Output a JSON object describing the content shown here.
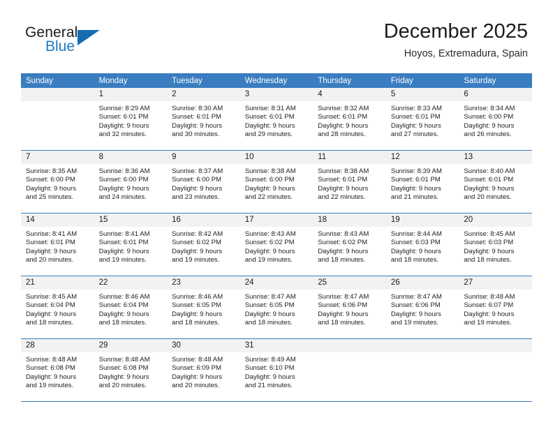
{
  "brand": {
    "name_part1": "General",
    "name_part2": "Blue",
    "accent_color": "#1f78c1",
    "flag_color": "#156cb0"
  },
  "header": {
    "month_title": "December 2025",
    "location": "Hoyos, Extremadura, Spain"
  },
  "calendar": {
    "header_bg": "#3a7dc0",
    "daynum_bg": "#f2f2f2",
    "weekday_headers": [
      "Sunday",
      "Monday",
      "Tuesday",
      "Wednesday",
      "Thursday",
      "Friday",
      "Saturday"
    ],
    "labels": {
      "sunrise": "Sunrise:",
      "sunset": "Sunset:",
      "daylight": "Daylight:"
    },
    "weeks": [
      [
        {
          "day": "",
          "empty": true
        },
        {
          "day": "1",
          "sunrise": "Sunrise: 8:29 AM",
          "sunset": "Sunset: 6:01 PM",
          "daylight_line1": "Daylight: 9 hours",
          "daylight_line2": "and 32 minutes."
        },
        {
          "day": "2",
          "sunrise": "Sunrise: 8:30 AM",
          "sunset": "Sunset: 6:01 PM",
          "daylight_line1": "Daylight: 9 hours",
          "daylight_line2": "and 30 minutes."
        },
        {
          "day": "3",
          "sunrise": "Sunrise: 8:31 AM",
          "sunset": "Sunset: 6:01 PM",
          "daylight_line1": "Daylight: 9 hours",
          "daylight_line2": "and 29 minutes."
        },
        {
          "day": "4",
          "sunrise": "Sunrise: 8:32 AM",
          "sunset": "Sunset: 6:01 PM",
          "daylight_line1": "Daylight: 9 hours",
          "daylight_line2": "and 28 minutes."
        },
        {
          "day": "5",
          "sunrise": "Sunrise: 8:33 AM",
          "sunset": "Sunset: 6:01 PM",
          "daylight_line1": "Daylight: 9 hours",
          "daylight_line2": "and 27 minutes."
        },
        {
          "day": "6",
          "sunrise": "Sunrise: 8:34 AM",
          "sunset": "Sunset: 6:00 PM",
          "daylight_line1": "Daylight: 9 hours",
          "daylight_line2": "and 26 minutes."
        }
      ],
      [
        {
          "day": "7",
          "sunrise": "Sunrise: 8:35 AM",
          "sunset": "Sunset: 6:00 PM",
          "daylight_line1": "Daylight: 9 hours",
          "daylight_line2": "and 25 minutes."
        },
        {
          "day": "8",
          "sunrise": "Sunrise: 8:36 AM",
          "sunset": "Sunset: 6:00 PM",
          "daylight_line1": "Daylight: 9 hours",
          "daylight_line2": "and 24 minutes."
        },
        {
          "day": "9",
          "sunrise": "Sunrise: 8:37 AM",
          "sunset": "Sunset: 6:00 PM",
          "daylight_line1": "Daylight: 9 hours",
          "daylight_line2": "and 23 minutes."
        },
        {
          "day": "10",
          "sunrise": "Sunrise: 8:38 AM",
          "sunset": "Sunset: 6:00 PM",
          "daylight_line1": "Daylight: 9 hours",
          "daylight_line2": "and 22 minutes."
        },
        {
          "day": "11",
          "sunrise": "Sunrise: 8:38 AM",
          "sunset": "Sunset: 6:01 PM",
          "daylight_line1": "Daylight: 9 hours",
          "daylight_line2": "and 22 minutes."
        },
        {
          "day": "12",
          "sunrise": "Sunrise: 8:39 AM",
          "sunset": "Sunset: 6:01 PM",
          "daylight_line1": "Daylight: 9 hours",
          "daylight_line2": "and 21 minutes."
        },
        {
          "day": "13",
          "sunrise": "Sunrise: 8:40 AM",
          "sunset": "Sunset: 6:01 PM",
          "daylight_line1": "Daylight: 9 hours",
          "daylight_line2": "and 20 minutes."
        }
      ],
      [
        {
          "day": "14",
          "sunrise": "Sunrise: 8:41 AM",
          "sunset": "Sunset: 6:01 PM",
          "daylight_line1": "Daylight: 9 hours",
          "daylight_line2": "and 20 minutes."
        },
        {
          "day": "15",
          "sunrise": "Sunrise: 8:41 AM",
          "sunset": "Sunset: 6:01 PM",
          "daylight_line1": "Daylight: 9 hours",
          "daylight_line2": "and 19 minutes."
        },
        {
          "day": "16",
          "sunrise": "Sunrise: 8:42 AM",
          "sunset": "Sunset: 6:02 PM",
          "daylight_line1": "Daylight: 9 hours",
          "daylight_line2": "and 19 minutes."
        },
        {
          "day": "17",
          "sunrise": "Sunrise: 8:43 AM",
          "sunset": "Sunset: 6:02 PM",
          "daylight_line1": "Daylight: 9 hours",
          "daylight_line2": "and 19 minutes."
        },
        {
          "day": "18",
          "sunrise": "Sunrise: 8:43 AM",
          "sunset": "Sunset: 6:02 PM",
          "daylight_line1": "Daylight: 9 hours",
          "daylight_line2": "and 18 minutes."
        },
        {
          "day": "19",
          "sunrise": "Sunrise: 8:44 AM",
          "sunset": "Sunset: 6:03 PM",
          "daylight_line1": "Daylight: 9 hours",
          "daylight_line2": "and 18 minutes."
        },
        {
          "day": "20",
          "sunrise": "Sunrise: 8:45 AM",
          "sunset": "Sunset: 6:03 PM",
          "daylight_line1": "Daylight: 9 hours",
          "daylight_line2": "and 18 minutes."
        }
      ],
      [
        {
          "day": "21",
          "sunrise": "Sunrise: 8:45 AM",
          "sunset": "Sunset: 6:04 PM",
          "daylight_line1": "Daylight: 9 hours",
          "daylight_line2": "and 18 minutes."
        },
        {
          "day": "22",
          "sunrise": "Sunrise: 8:46 AM",
          "sunset": "Sunset: 6:04 PM",
          "daylight_line1": "Daylight: 9 hours",
          "daylight_line2": "and 18 minutes."
        },
        {
          "day": "23",
          "sunrise": "Sunrise: 8:46 AM",
          "sunset": "Sunset: 6:05 PM",
          "daylight_line1": "Daylight: 9 hours",
          "daylight_line2": "and 18 minutes."
        },
        {
          "day": "24",
          "sunrise": "Sunrise: 8:47 AM",
          "sunset": "Sunset: 6:05 PM",
          "daylight_line1": "Daylight: 9 hours",
          "daylight_line2": "and 18 minutes."
        },
        {
          "day": "25",
          "sunrise": "Sunrise: 8:47 AM",
          "sunset": "Sunset: 6:06 PM",
          "daylight_line1": "Daylight: 9 hours",
          "daylight_line2": "and 18 minutes."
        },
        {
          "day": "26",
          "sunrise": "Sunrise: 8:47 AM",
          "sunset": "Sunset: 6:06 PM",
          "daylight_line1": "Daylight: 9 hours",
          "daylight_line2": "and 19 minutes."
        },
        {
          "day": "27",
          "sunrise": "Sunrise: 8:48 AM",
          "sunset": "Sunset: 6:07 PM",
          "daylight_line1": "Daylight: 9 hours",
          "daylight_line2": "and 19 minutes."
        }
      ],
      [
        {
          "day": "28",
          "sunrise": "Sunrise: 8:48 AM",
          "sunset": "Sunset: 6:08 PM",
          "daylight_line1": "Daylight: 9 hours",
          "daylight_line2": "and 19 minutes."
        },
        {
          "day": "29",
          "sunrise": "Sunrise: 8:48 AM",
          "sunset": "Sunset: 6:08 PM",
          "daylight_line1": "Daylight: 9 hours",
          "daylight_line2": "and 20 minutes."
        },
        {
          "day": "30",
          "sunrise": "Sunrise: 8:48 AM",
          "sunset": "Sunset: 6:09 PM",
          "daylight_line1": "Daylight: 9 hours",
          "daylight_line2": "and 20 minutes."
        },
        {
          "day": "31",
          "sunrise": "Sunrise: 8:49 AM",
          "sunset": "Sunset: 6:10 PM",
          "daylight_line1": "Daylight: 9 hours",
          "daylight_line2": "and 21 minutes."
        },
        {
          "day": "",
          "empty": true
        },
        {
          "day": "",
          "empty": true
        },
        {
          "day": "",
          "empty": true
        }
      ]
    ]
  }
}
